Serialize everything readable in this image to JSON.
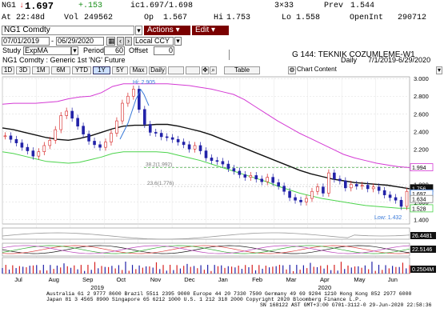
{
  "quote": {
    "ticker": "NG1",
    "arrow": "↓",
    "last": "1.697",
    "change": "+.153",
    "bid_ask": "ic1.697/1.698",
    "size": "3×33",
    "prev_label": "Prev",
    "prev": "1.544",
    "time_label": "At",
    "time": "22:48d",
    "vol_label": "Vol",
    "vol": "249562",
    "open_label": "Op",
    "open": "1.567",
    "high_label": "Hi",
    "high": "1.753",
    "low_label": "Lo",
    "low": "1.558",
    "oi_label": "OpenInt",
    "oi": "290712"
  },
  "toolbar": {
    "security": "NG1 Comdty",
    "actions": "Actions",
    "edit": "Edit",
    "title": "G 144: TEKNIK COZUMLEME-W1"
  },
  "controls": {
    "start_date": "07/01/2019",
    "end_date": "06/29/2020",
    "currency": "Local CCY",
    "study_label": "Study",
    "study": "ExpMA",
    "period_label": "Period",
    "period": "60",
    "offset_label": "Offset",
    "offset": "0",
    "description": "NG1 Comdty : Generic 1st 'NG' Future",
    "frequency": "Daily",
    "date_range": "7/1/2019-6/29/2020"
  },
  "ranges": [
    "1D",
    "3D",
    "1M",
    "6M",
    "YTD",
    "1Y",
    "5Y",
    "Max",
    "Daily",
    "",
    ""
  ],
  "active_range": "1Y",
  "chart_tools": {
    "table": "Table",
    "chart_content": "Chart Content"
  },
  "chart_data": {
    "type": "line",
    "title": "NG1 Comdty : Generic 1st 'NG' Future",
    "annotations": {
      "high": "Hi: 2.905",
      "low": "Low: 1.432",
      "fib1": "38.2(1.992)",
      "fib2": "23.6(1.776)"
    },
    "price_ticks": [
      "3.000",
      "2.800",
      "2.600",
      "2.400",
      "2.200",
      "2.000",
      "1.800",
      "1.600",
      "1.400"
    ],
    "price_labels": {
      "ma_upper": "1.994",
      "ma_mid": "1.756",
      "last": "1.697",
      "p2": "1.634",
      "lower": "1.528"
    },
    "ylim": [
      1.35,
      3.02
    ],
    "months": [
      "Jul",
      "Aug",
      "Sep",
      "Oct",
      "Nov",
      "Dec",
      "Jan",
      "Feb",
      "Mar",
      "Apr",
      "May",
      "Jun"
    ],
    "years": [
      "2019",
      "2020"
    ],
    "series": [
      {
        "name": "Price",
        "values": [
          2.35,
          2.31,
          2.27,
          2.22,
          2.18,
          2.12,
          2.17,
          2.24,
          2.3,
          2.42,
          2.58,
          2.63,
          2.55,
          2.46,
          2.37,
          2.29,
          2.25,
          2.22,
          2.28,
          2.38,
          2.52,
          2.72,
          2.8,
          2.88,
          2.65,
          2.48,
          2.39,
          2.38,
          2.34,
          2.33,
          2.31,
          2.28,
          2.25,
          2.2,
          2.24,
          2.18,
          2.1,
          2.07,
          2.06,
          2.03,
          1.98,
          1.95,
          1.91,
          1.88,
          1.9,
          1.86,
          1.83,
          1.88,
          1.82,
          1.78,
          1.72,
          1.65,
          1.62,
          1.6,
          1.64,
          1.72,
          1.77,
          1.7,
          1.93,
          1.86,
          1.84,
          1.76,
          1.8,
          1.78,
          1.79,
          1.75,
          1.77,
          1.73,
          1.68,
          1.65,
          1.62,
          1.55,
          1.72
        ]
      },
      {
        "name": "MA upper",
        "values": [
          2.71,
          2.72,
          2.72,
          2.72,
          2.73,
          2.74,
          2.77,
          2.79,
          2.8,
          2.84,
          2.91,
          2.94,
          2.94,
          2.94,
          2.94,
          2.94,
          2.93,
          2.92,
          2.9,
          2.88,
          2.85,
          2.82,
          2.76,
          2.68,
          2.6,
          2.52,
          2.45,
          2.38,
          2.32,
          2.26,
          2.2,
          2.14,
          2.1,
          2.07,
          2.04,
          2.02,
          2.0,
          1.99
        ]
      },
      {
        "name": "MA mid",
        "values": [
          2.44,
          2.42,
          2.39,
          2.36,
          2.33,
          2.31,
          2.3,
          2.32,
          2.35,
          2.39,
          2.43,
          2.46,
          2.47,
          2.47,
          2.48,
          2.48,
          2.46,
          2.43,
          2.4,
          2.36,
          2.31,
          2.26,
          2.21,
          2.16,
          2.11,
          2.06,
          2.01,
          1.96,
          1.92,
          1.89,
          1.86,
          1.84,
          1.82,
          1.81,
          1.8,
          1.79,
          1.77,
          1.75
        ]
      },
      {
        "name": "MA lower",
        "values": [
          2.17,
          2.15,
          2.12,
          2.09,
          2.06,
          2.05,
          2.04,
          2.05,
          2.08,
          2.11,
          2.15,
          2.17,
          2.17,
          2.17,
          2.17,
          2.16,
          2.13,
          2.1,
          2.07,
          2.03,
          1.99,
          1.95,
          1.91,
          1.87,
          1.83,
          1.78,
          1.74,
          1.7,
          1.67,
          1.64,
          1.62,
          1.6,
          1.58,
          1.56,
          1.55,
          1.54,
          1.53,
          1.53
        ]
      }
    ],
    "indicator_labels": {
      "ind1": "26.4481",
      "ind2": "22.5146",
      "ind3": "0.2504M"
    }
  },
  "footer": {
    "line1": "Australia 61 2 9777 8600  Brazil 5511 2395 9000  Europe 44 20 7330 7500  Germany 49 69 9204 1210  Hong Kong 852 2977 6000",
    "line2": "Japan 81 3 4565 8900        Singapore 65 6212 1000        U.S. 1 212 318 2000          Copyright 2020 Bloomberg Finance L.P.",
    "line3": "SN 168122 AST  GMT+3:00  G701-3112-0 29-Jun-2020 22:58:36"
  },
  "colors": {
    "price_up": "#d62222",
    "price_down": "#2222a8",
    "ma_upper": "#d43ad4",
    "ma_mid": "#111111",
    "ma_lower": "#4cd44c",
    "fib": "#44aa44",
    "accent_dark": "#7a0000"
  }
}
